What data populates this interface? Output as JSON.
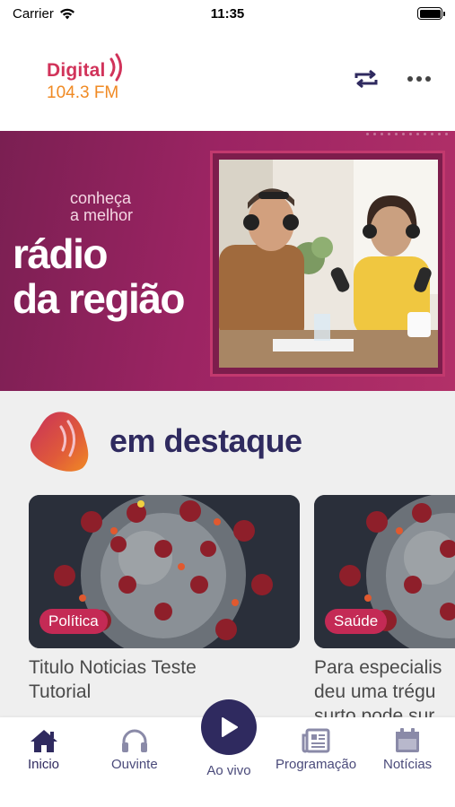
{
  "status_bar": {
    "carrier": "Carrier",
    "time": "11:35"
  },
  "header": {
    "logo_name": "Digital",
    "logo_freq": "104.3 FM",
    "icons": [
      "repeat-icon",
      "more-icon"
    ]
  },
  "hero": {
    "small_line_1": "conheça",
    "small_line_2": "a melhor",
    "big_line_1": "rádio",
    "big_line_2": "da região"
  },
  "featured": {
    "title": "em destaque",
    "cards": [
      {
        "tag": "Política",
        "title_line_1": "Titulo Noticias Teste",
        "title_line_2": "Tutorial",
        "title_line_3": ""
      },
      {
        "tag": "Saúde",
        "title_line_1": "Para especialis",
        "title_line_2": "deu uma trégu",
        "title_line_3": "surto pode sur"
      }
    ]
  },
  "bottom_nav": {
    "items": [
      {
        "label": "Inicio",
        "icon": "home-icon"
      },
      {
        "label": "Ouvinte",
        "icon": "headphones-icon"
      },
      {
        "label": "Ao vivo",
        "icon": "play-icon"
      },
      {
        "label": "Programação",
        "icon": "newspaper-icon"
      },
      {
        "label": "Notícias",
        "icon": "calendar-icon"
      }
    ]
  },
  "colors": {
    "brand_pink": "#d1335a",
    "brand_orange": "#f08a24",
    "navy": "#2f2a5f",
    "hero_bg": "#9c2463",
    "tag_bg": "#c42a55"
  }
}
